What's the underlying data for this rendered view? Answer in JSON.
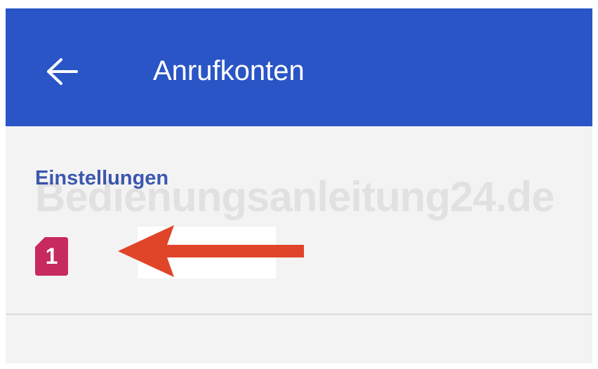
{
  "app_bar": {
    "title": "Anrufkonten",
    "back_icon": "arrow-left-icon",
    "background_color": "#2a55c6"
  },
  "settings": {
    "section_header": "Einstellungen",
    "header_color": "#3b57b0"
  },
  "sim_entry": {
    "slot_number": "1",
    "icon": "sim-card-icon",
    "icon_color": "#c62a5f"
  },
  "watermark": {
    "text": "Bedienungsanleitung24.de"
  },
  "annotation": {
    "icon": "red-arrow-left-icon",
    "color": "#e0452a"
  }
}
